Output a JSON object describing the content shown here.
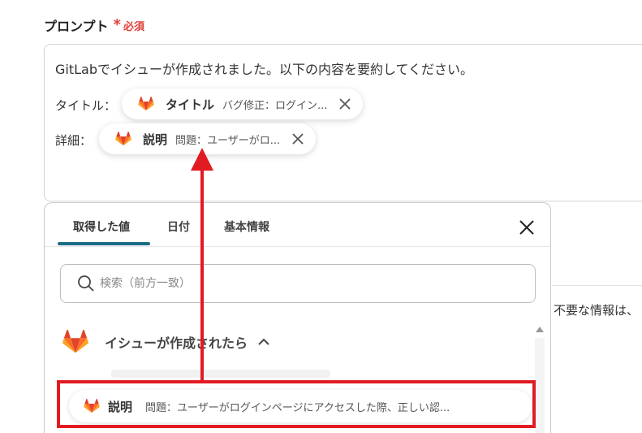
{
  "field": {
    "label": "プロンプト",
    "required_mark": "*",
    "required_text": "必須"
  },
  "prompt": {
    "text": "GitLabでイシューが作成されました。以下の内容を要約してください。",
    "title_label": "タイトル：",
    "detail_label": "詳細："
  },
  "chips": {
    "title": {
      "name": "タイトル",
      "value": "バグ修正：ログイン...",
      "icon": "gitlab-icon"
    },
    "detail": {
      "name": "説明",
      "value": "問題：ユーザーがロ...",
      "icon": "gitlab-icon"
    }
  },
  "side_text": "不要な情報は、",
  "panel": {
    "tabs": [
      "取得した値",
      "日付",
      "基本情報"
    ],
    "active_tab": 0,
    "search_placeholder": "検索（前方一致）",
    "section_title": "イシューが作成されたら",
    "item": {
      "name": "説明",
      "value": "問題：ユーザーがログインページにアクセスした際、正しい認..."
    }
  },
  "colors": {
    "required": "#e0403a",
    "tab_underline": "#1a6b86",
    "highlight": "#e21b23",
    "gitlab_orange": "#e24329",
    "gitlab_light": "#fc6d26",
    "gitlab_yellow": "#fca326"
  }
}
